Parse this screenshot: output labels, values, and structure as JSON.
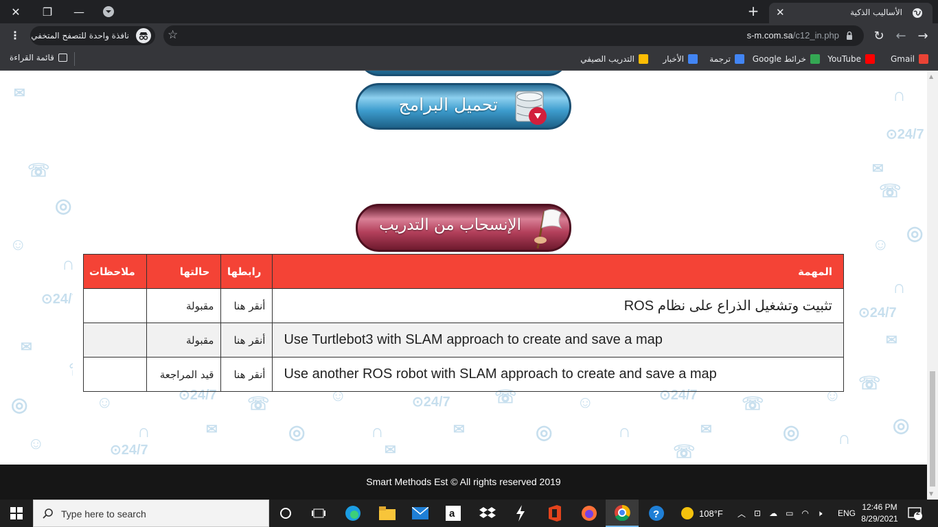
{
  "browser": {
    "tab_title": "الأساليب الذكية",
    "incognito_label": "نافذة واحدة للتصفح المتخفي",
    "url_host": "s-m.com.sa",
    "url_path": "/c12_in.php",
    "reading_list": "قائمة القراءة",
    "bookmarks": [
      "Gmail",
      "YouTube",
      "خرائط Google",
      "ترجمة",
      "الأخبار",
      "التدريب الصيفي"
    ],
    "bookmark_colors": [
      "#ea4335",
      "#ff0000",
      "#34a853",
      "#4285f4",
      "#4285f4",
      "#fbbc04"
    ]
  },
  "page": {
    "download_button": "تحميل البرامج",
    "withdraw_button": "الإنسحاب من التدريب",
    "table": {
      "headers": {
        "task": "المهمة",
        "link": "رابطها",
        "status": "حالتها",
        "notes": "ملاحظات"
      },
      "rows": [
        {
          "task": "تثبيت وتشغيل الذراع على نظام ROS",
          "link": "أنقر هنا",
          "status": "مقبولة",
          "notes": ""
        },
        {
          "task": "Use Turtlebot3 with SLAM approach to create and save a map",
          "link": "أنقر هنا",
          "status": "مقبولة",
          "notes": ""
        },
        {
          "task": "Use another ROS robot with SLAM approach to create and save a map",
          "link": "أنقر هنا",
          "status": "قيد المراجعة",
          "notes": ""
        }
      ]
    },
    "footer": "Smart Methods Est © All rights reserved 2019",
    "accent_color": "#f44336"
  },
  "taskbar": {
    "search_placeholder": "Type here to search",
    "weather": "108°F",
    "language": "ENG",
    "time": "12:46 PM",
    "date": "8/29/2021",
    "notifications": "2"
  }
}
